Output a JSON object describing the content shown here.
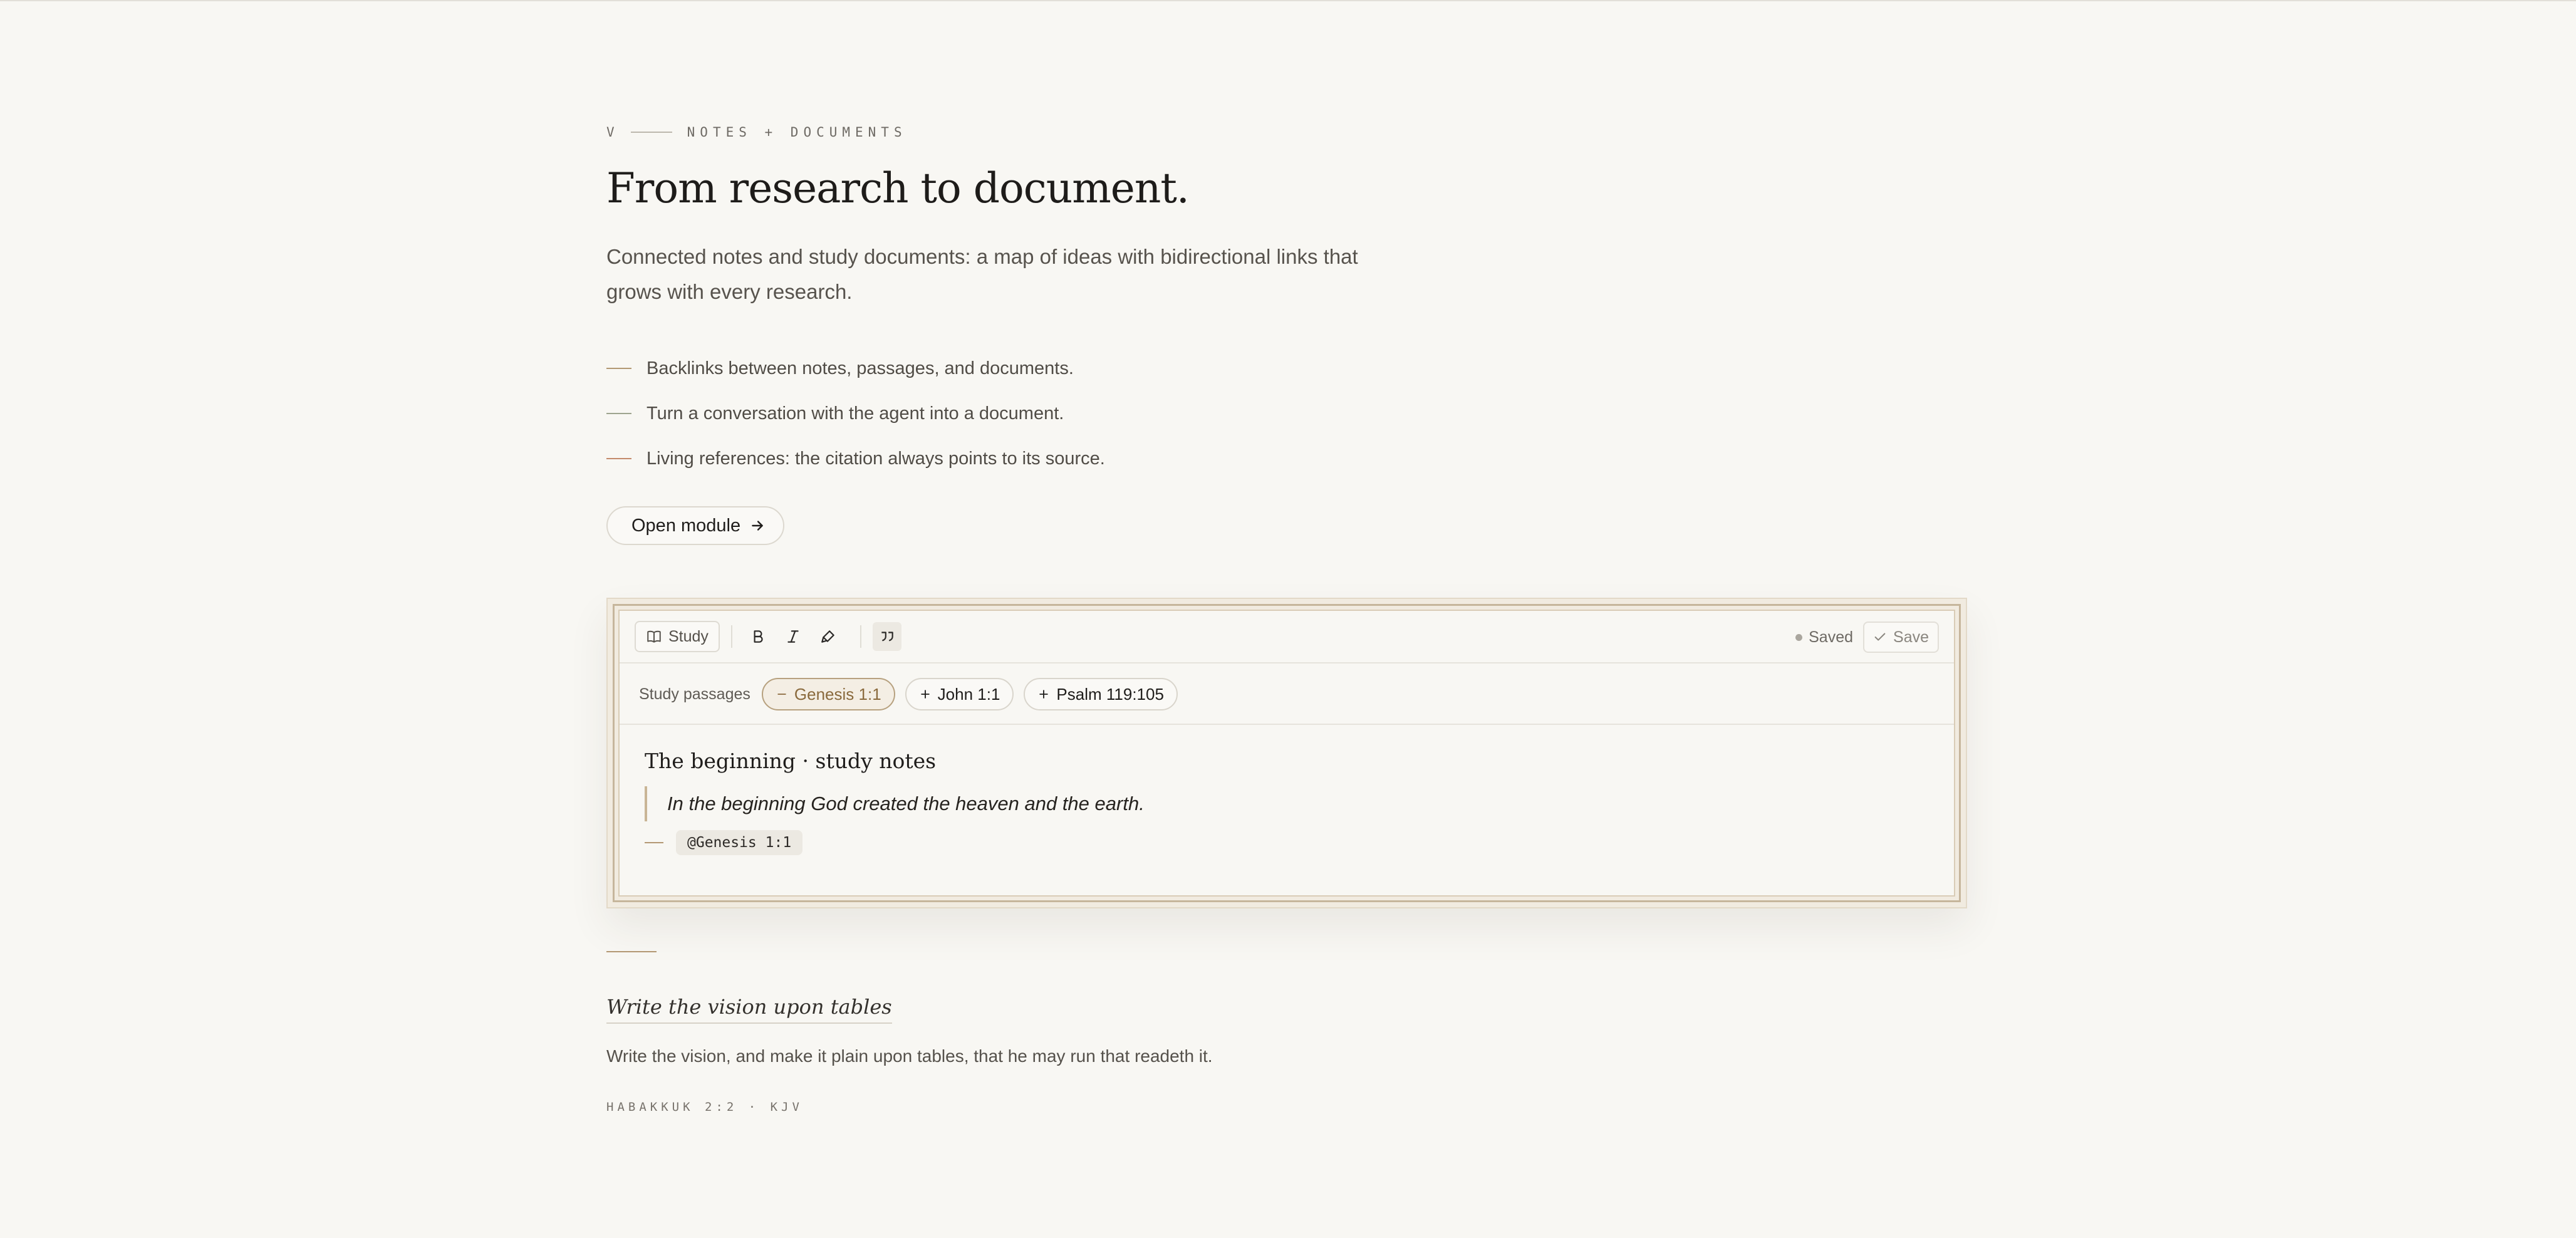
{
  "section": {
    "eyebrow_mark": "V",
    "eyebrow_label": "NOTES + DOCUMENTS",
    "title": "From research to document.",
    "lede": "Connected notes and study documents: a map of ideas with bidirectional links that grows with every research.",
    "features": [
      "Backlinks between notes, passages, and documents.",
      "Turn a conversation with the agent into a document.",
      "Living references: the citation always points to its source."
    ],
    "open_button": "Open module"
  },
  "editor": {
    "toolbar": {
      "study_label": "Study",
      "icons": [
        "bold-icon",
        "italic-icon",
        "highlight-icon",
        "quote-icon"
      ],
      "saved_status": "Saved",
      "save_label": "Save"
    },
    "passages": {
      "label": "Study passages",
      "chips": [
        {
          "label": "Genesis 1:1",
          "active": true
        },
        {
          "label": "John 1:1",
          "active": false
        },
        {
          "label": "Psalm 119:105",
          "active": false
        }
      ]
    },
    "doc": {
      "title": "The beginning · study notes",
      "quote": "In the beginning God created the heaven and the earth.",
      "reference": "@Genesis 1:1"
    }
  },
  "verse": {
    "title": "Write the vision upon tables",
    "text": "Write the vision, and make it plain upon tables, that he may run that readeth it.",
    "reference": "HABAKKUK 2:2 · KJV"
  },
  "colors": {
    "background": "#f8f7f3",
    "accent": "#b39873",
    "frame": "#c6b69c",
    "active_chip_text": "#8a6a3d"
  }
}
